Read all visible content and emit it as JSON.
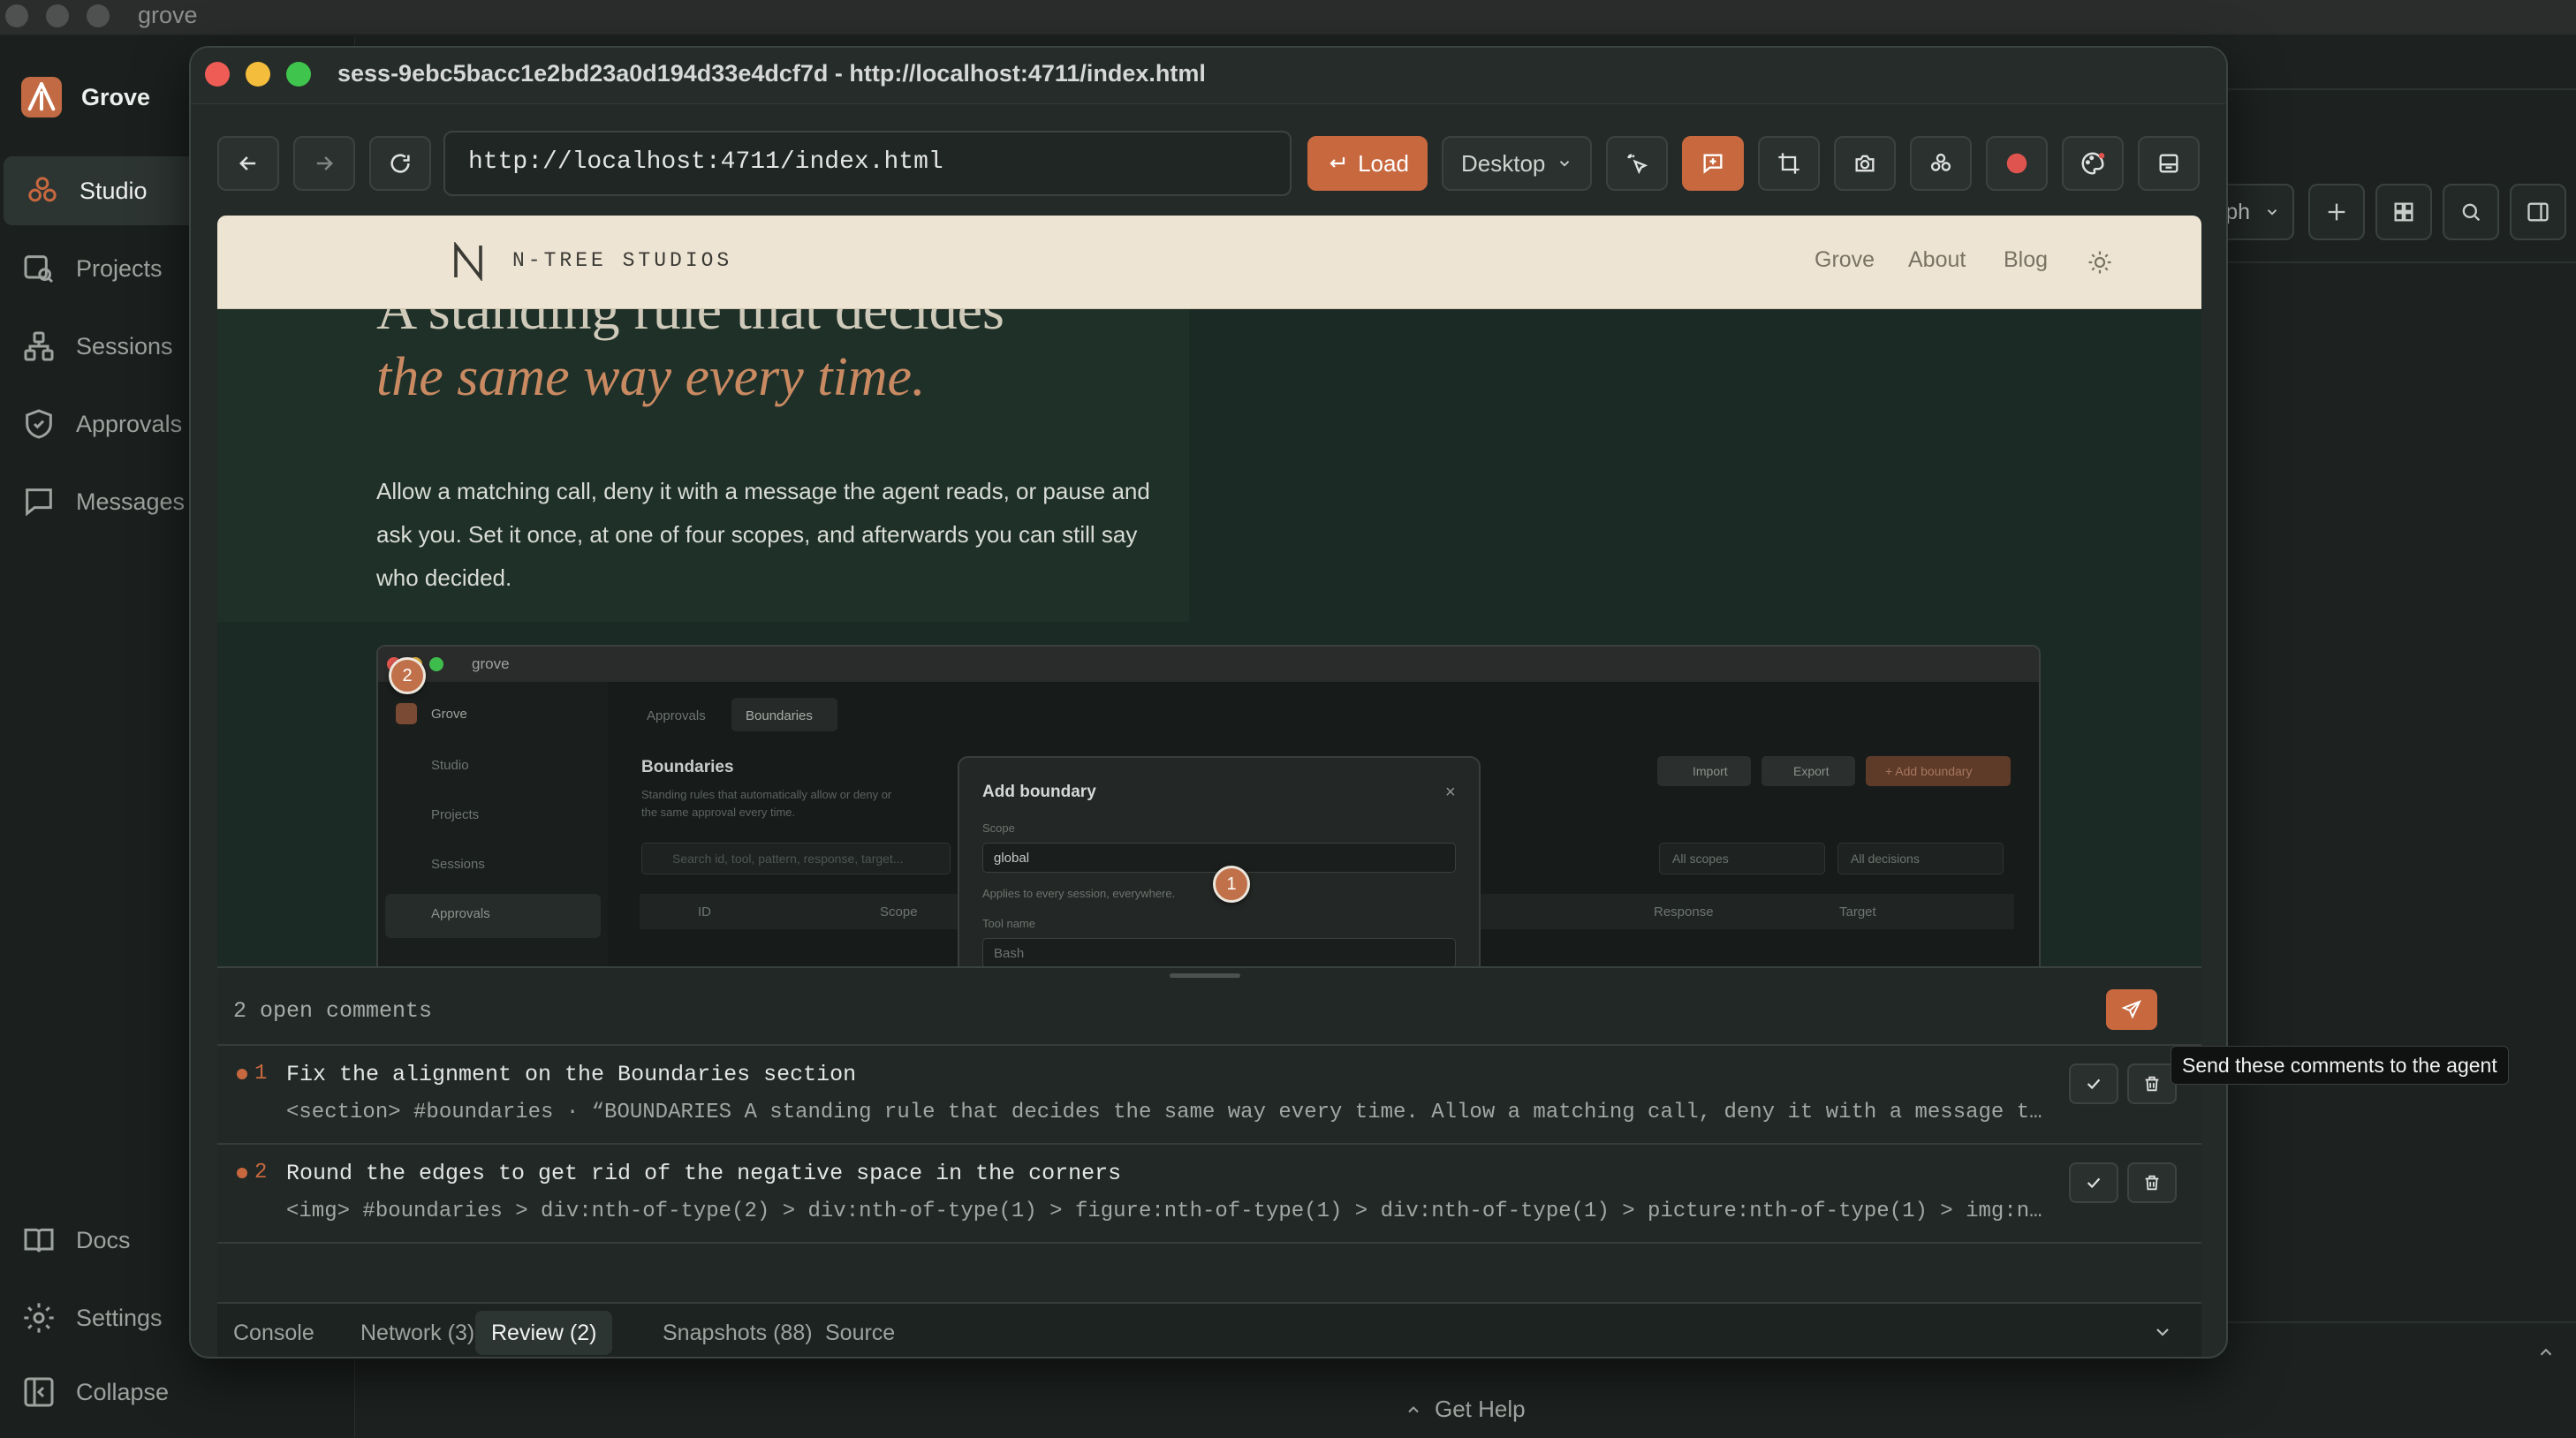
{
  "os": {
    "title": "grove"
  },
  "sidebar": {
    "brand": "Grove",
    "items": [
      {
        "label": "Studio",
        "icon": "studio-icon",
        "active": true
      },
      {
        "label": "Projects",
        "icon": "projects-icon"
      },
      {
        "label": "Sessions",
        "icon": "sessions-icon"
      },
      {
        "label": "Approvals",
        "icon": "shield-icon"
      },
      {
        "label": "Messages",
        "icon": "message-icon"
      }
    ],
    "bottom": [
      {
        "label": "Docs",
        "icon": "book-icon"
      },
      {
        "label": "Settings",
        "icon": "gear-icon"
      },
      {
        "label": "Collapse",
        "icon": "collapse-icon"
      }
    ]
  },
  "right_toolbar": {
    "select_fragment": "ph"
  },
  "footer": {
    "help": "Get Help"
  },
  "window": {
    "title": "sess-9ebc5bacc1e2bd23a0d194d33e4dcf7d - http://localhost:4711/index.html",
    "url": "http://localhost:4711/index.html",
    "load_label": "Load",
    "device": "Desktop"
  },
  "site": {
    "brand": "N-TREE STUDIOS",
    "nav": [
      "Grove",
      "About",
      "Blog"
    ],
    "hero_partial": "A standing rule that decides",
    "hero_italic": "the same way every time.",
    "hero_body": "Allow a matching call, deny it with a message the agent reads, or pause and ask you. Set it once, at one of four scopes, and afterwards you can still say who decided."
  },
  "inner_shot": {
    "app_title": "grove",
    "brand": "Grove",
    "nav": [
      "Studio",
      "Projects",
      "Sessions",
      "Approvals"
    ],
    "tabs": [
      "Approvals",
      "Boundaries"
    ],
    "section_title": "Boundaries",
    "section_desc": "Standing rules that automatically allow or deny or",
    "section_desc2": "the same approval every time.",
    "search_placeholder": "Search id, tool, pattern, response, target...",
    "buttons": [
      "Import",
      "Export",
      "+ Add boundary"
    ],
    "filters": [
      "All scopes",
      "All decisions"
    ],
    "columns": [
      "ID",
      "Scope",
      "Response",
      "Target"
    ],
    "modal": {
      "title": "Add boundary",
      "scope_label": "Scope",
      "scope_value": "global",
      "scope_help": "Applies to every session, everywhere.",
      "tool_label": "Tool name",
      "tool_value": "Bash"
    },
    "pins": [
      "1",
      "2"
    ]
  },
  "review": {
    "open_count": "2 open comments",
    "send_tooltip": "Send these comments to the agent",
    "comments": [
      {
        "num": "1",
        "text": "Fix the alignment on the Boundaries section",
        "selector": "<section> #boundaries · “BOUNDARIES A standing rule that decides the same way every time. Allow a matching call, deny it with a message t…"
      },
      {
        "num": "2",
        "text": "Round the edges to get rid of the negative space in the corners",
        "selector": "<img> #boundaries > div:nth-of-type(2) > div:nth-of-type(1) > figure:nth-of-type(1) > div:nth-of-type(1) > picture:nth-of-type(1) > img:n…"
      }
    ]
  },
  "devtools": {
    "tabs": [
      "Console",
      "Network (3)",
      "Review (2)",
      "Snapshots (88)",
      "Source"
    ],
    "active": "Review (2)"
  },
  "colors": {
    "accent": "#c7683f",
    "bg": "#1d2220",
    "record": "#e0544f"
  }
}
